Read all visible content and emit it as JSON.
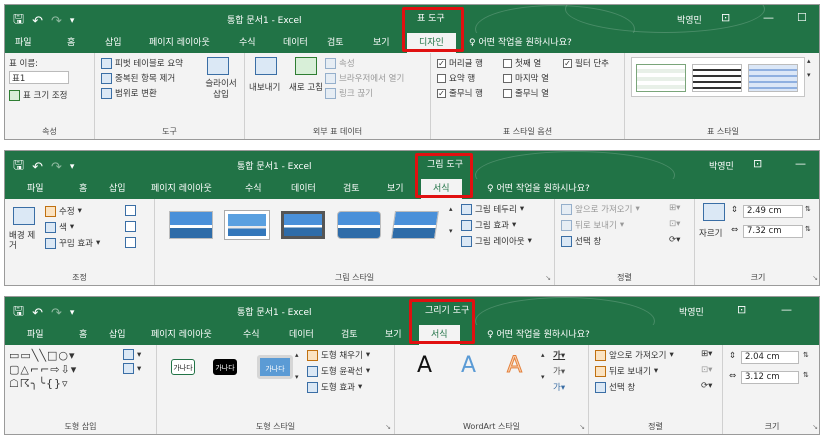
{
  "common": {
    "doc_title": "통합 문서1 - Excel",
    "user": "박영민",
    "search_prompt": "어떤 작업을 원하시나요?",
    "tabs": [
      "파일",
      "홈",
      "삽입",
      "페이지 레이아웃",
      "수식",
      "데이터",
      "검토",
      "보기"
    ],
    "accent": "#217346",
    "highlight": "#e01010"
  },
  "panel1": {
    "context_label": "표 도구",
    "active_tab": "디자인",
    "props": {
      "name_label": "표 이름:",
      "name_value": "표1",
      "resize": "표 크기 조정",
      "group": "속성"
    },
    "tools": {
      "pivot": "피벗 테이블로 요약",
      "dedupe": "중복된 항목 제거",
      "convert": "범위로 변환",
      "slicer": "슬라이서 삽입",
      "group": "도구"
    },
    "external": {
      "export": "내보내기",
      "refresh": "새로 고침",
      "properties": "속성",
      "browser": "브라우저에서 열기",
      "unlink": "링크 끊기",
      "group": "외부 표 데이터"
    },
    "style_options": {
      "header_row": "머리글 행",
      "first_col": "첫째 열",
      "filter_btn": "필터 단추",
      "total_row": "요약 행",
      "last_col": "마지막 열",
      "banded_rows": "줄무늬 행",
      "banded_cols": "줄무늬 열",
      "checked": {
        "header_row": true,
        "first_col": false,
        "filter_btn": true,
        "total_row": false,
        "last_col": false,
        "banded_rows": true,
        "banded_cols": false
      },
      "group": "표 스타일 옵션"
    },
    "styles_group": "표 스타일"
  },
  "panel2": {
    "context_label": "그림 도구",
    "active_tab": "서식",
    "adjust": {
      "remove_bg": "배경 제거",
      "corrections": "수정",
      "color": "색",
      "artistic": "꾸밈 효과",
      "group": "조정"
    },
    "styles": {
      "border": "그림 테두리",
      "effects": "그림 효과",
      "layout": "그림 레이아웃",
      "group": "그림 스타일"
    },
    "arrange": {
      "forward": "앞으로 가져오기",
      "backward": "뒤로 보내기",
      "selection": "선택 창",
      "group": "정렬"
    },
    "size": {
      "crop": "자르기",
      "height": "2.49 cm",
      "width": "7.32 cm",
      "group": "크기"
    }
  },
  "panel3": {
    "context_label": "그리기 도구",
    "active_tab": "서식",
    "insert_shapes_group": "도형 삽입",
    "shape_styles": {
      "sample": "가나다",
      "fill": "도형 채우기",
      "outline": "도형 윤곽선",
      "effects": "도형 효과",
      "group": "도형 스타일"
    },
    "wordart": {
      "letter": "A",
      "group": "WordArt 스타일"
    },
    "arrange": {
      "forward": "앞으로 가져오기",
      "backward": "뒤로 보내기",
      "selection": "선택 창",
      "group": "정렬"
    },
    "size": {
      "height": "2.04 cm",
      "width": "3.12 cm",
      "group": "크기"
    }
  }
}
